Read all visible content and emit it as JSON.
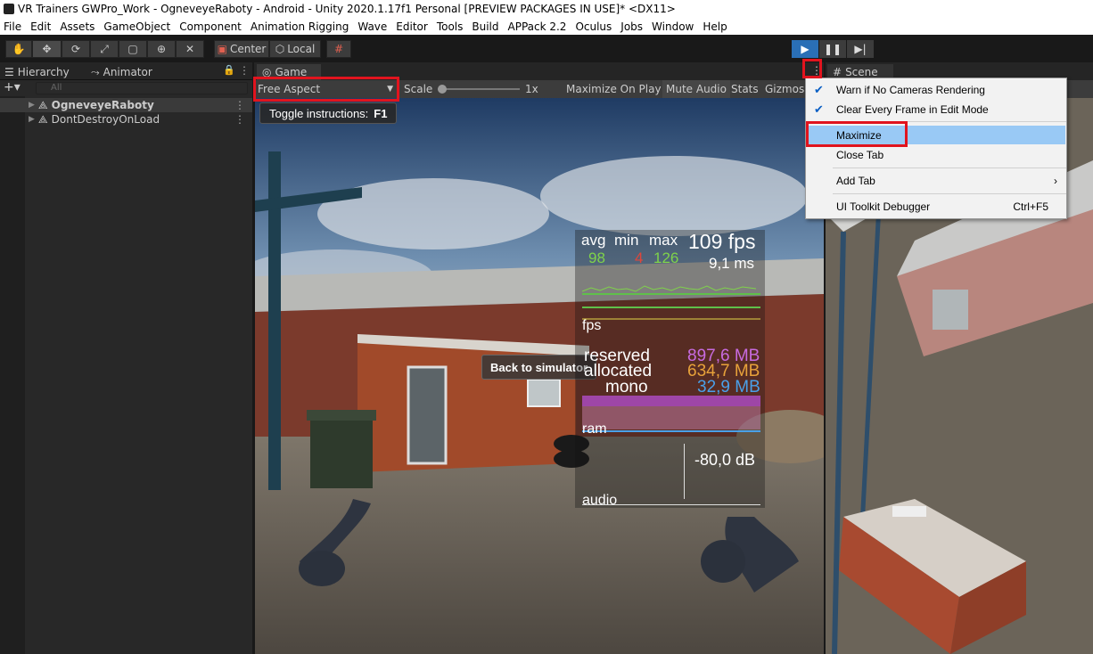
{
  "window": {
    "title": "VR Trainers GWPro_Work - OgneveyeRaboty - Android - Unity 2020.1.17f1 Personal [PREVIEW PACKAGES IN USE]* <DX11>"
  },
  "menu": [
    "File",
    "Edit",
    "Assets",
    "GameObject",
    "Component",
    "Animation Rigging",
    "Wave",
    "Editor",
    "Tools",
    "Build",
    "APPack 2.2",
    "Oculus",
    "Jobs",
    "Window",
    "Help"
  ],
  "toolbar": {
    "pivot_label": "Center",
    "space_label": "Local"
  },
  "hierarchy": {
    "tab_label": "Hierarchy",
    "animator_tab_label": "Animator",
    "search_placeholder": "All",
    "items": [
      {
        "label": "OgneveyeRaboty"
      },
      {
        "label": "DontDestroyOnLoad"
      }
    ]
  },
  "game": {
    "tab_label": "Game",
    "aspect": "Free Aspect",
    "scale_label": "Scale",
    "scale_value": "1x",
    "maximize_on_play": "Maximize On Play",
    "mute_audio": "Mute Audio",
    "stats": "Stats",
    "gizmos": "Gizmos",
    "toggle_instructions": "Toggle instructions:",
    "toggle_key": "F1",
    "back_button": "Back to simulator"
  },
  "scene": {
    "tab_label": "Scene"
  },
  "overlay": {
    "avg_label": "avg",
    "min_label": "min",
    "max_label": "max",
    "avg": "98",
    "min": "4",
    "max": "126",
    "fps_value": "109 fps",
    "ms_value": "9,1 ms",
    "fps_graph_label": "fps",
    "reserved_label": "reserved",
    "reserved_value": "897,6 MB",
    "allocated_label": "allocated",
    "allocated_value": "634,7 MB",
    "mono_label": "mono",
    "mono_value": "32,9 MB",
    "ram_label": "ram",
    "audio_value": "-80,0 dB",
    "audio_label": "audio",
    "colors": {
      "avg": "#7fd34a",
      "min": "#e0463a",
      "max": "#7fd34a",
      "reserved": "#c86be0",
      "allocated": "#e8a23a",
      "mono": "#4aa0e8"
    }
  },
  "context_menu": {
    "items": [
      {
        "label": "Warn if No Cameras Rendering",
        "checked": true
      },
      {
        "label": "Clear Every Frame in Edit Mode",
        "checked": true
      },
      {
        "label": "Maximize",
        "highlighted": true
      },
      {
        "label": "Close Tab"
      },
      {
        "label": "Add Tab",
        "submenu": true
      },
      {
        "label": "UI Toolkit Debugger",
        "shortcut": "Ctrl+F5"
      }
    ]
  }
}
